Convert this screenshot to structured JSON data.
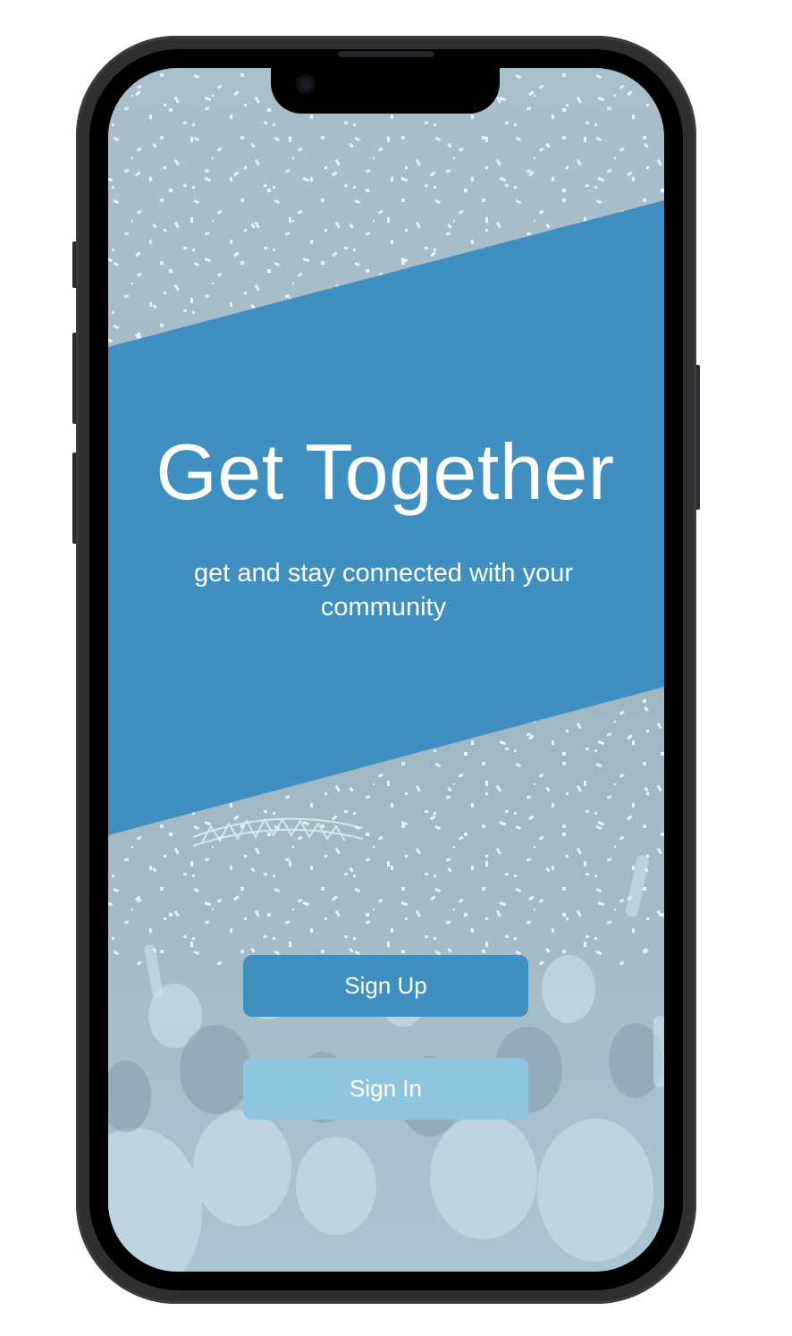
{
  "app": {
    "title": "Get Together",
    "subtitle": "get and stay connected with your community"
  },
  "actions": {
    "sign_up_label": "Sign Up",
    "sign_in_label": "Sign In"
  },
  "colors": {
    "banner": "#3f8fc0",
    "sign_up_button": "#3f8fc0",
    "sign_in_button": "#8fc5de",
    "background_photo_tint": "#a5b9c6",
    "device_frame": "#2f2f31"
  },
  "icons": {
    "camera": "front-camera-icon"
  }
}
